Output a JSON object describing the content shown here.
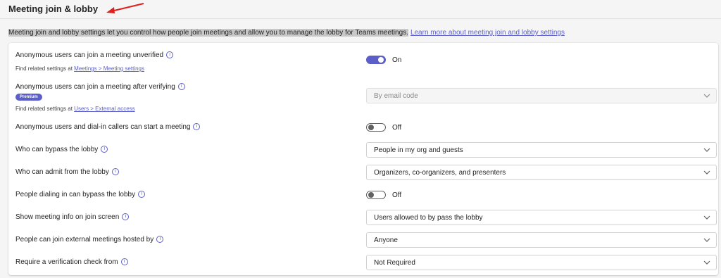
{
  "section": {
    "title": "Meeting join & lobby",
    "description": "Meeting join and lobby settings let you control how people join meetings and allow you to manage the lobby for Teams meetings.",
    "learn_more": "Learn more about meeting join and lobby settings"
  },
  "rows": [
    {
      "label": "Anonymous users can join a meeting unverified",
      "sub_prefix": "Find related settings at",
      "sub_link": "Meetings > Meeting settings",
      "toggle": "On"
    },
    {
      "label": "Anonymous users can join a meeting after verifying",
      "badge": "Premium",
      "sub_prefix": "Find related settings at",
      "sub_link": "Users > External access",
      "select": "By email code"
    },
    {
      "label": "Anonymous users and dial-in callers can start a meeting",
      "toggle": "Off"
    },
    {
      "label": "Who can bypass the lobby",
      "select": "People in my org and guests"
    },
    {
      "label": "Who can admit from the lobby",
      "select": "Organizers, co-organizers, and presenters"
    },
    {
      "label": "People dialing in can bypass the lobby",
      "toggle": "Off"
    },
    {
      "label": "Show meeting info on join screen",
      "select": "Users allowed to by pass the lobby"
    },
    {
      "label": "People can join external meetings hosted by",
      "select": "Anyone"
    },
    {
      "label": "Require a verification check from",
      "select": "Not Required"
    }
  ],
  "icons": {
    "info": "info-icon",
    "chevron": "chevron-down-icon",
    "arrow": "red-arrow-annotation"
  },
  "colors": {
    "accent": "#5b5fc7",
    "arrow": "#e02020"
  }
}
